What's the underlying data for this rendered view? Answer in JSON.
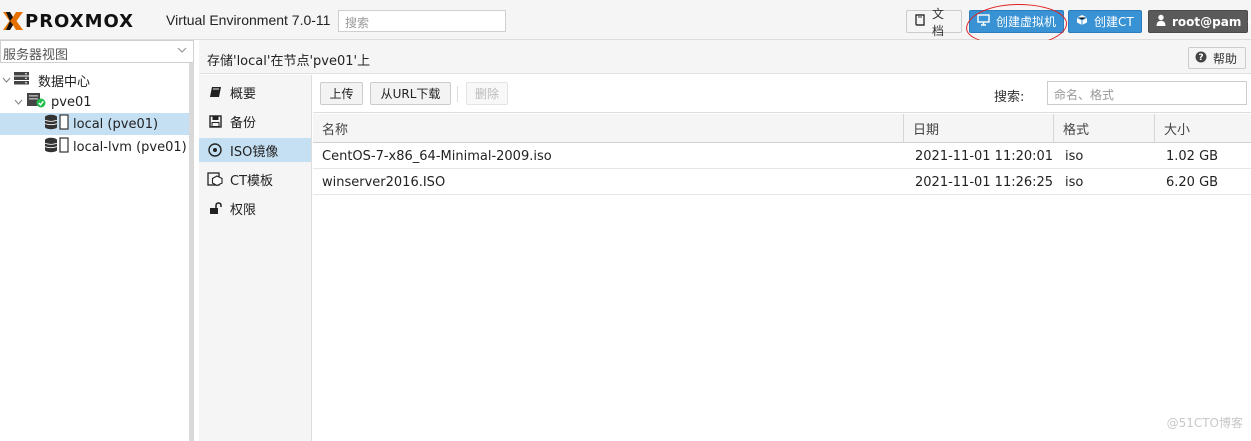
{
  "header": {
    "logo_text": "PROXMOX",
    "version": "Virtual Environment 7.0-11",
    "search_placeholder": "搜索",
    "docs_label": "文档",
    "create_vm_label": "创建虚拟机",
    "create_ct_label": "创建CT",
    "user_label": "root@pam"
  },
  "sidebar": {
    "view_selector": "服务器视图",
    "tree": [
      {
        "label": "数据中心",
        "icon": "datacenter-icon"
      },
      {
        "label": "pve01",
        "icon": "node-online-icon"
      },
      {
        "label": "local (pve01)",
        "icon": "storage-icon",
        "selected": true
      },
      {
        "label": "local-lvm (pve01)",
        "icon": "storage-icon"
      }
    ]
  },
  "main": {
    "title": "存储'local'在节点'pve01'上",
    "help_label": "帮助",
    "nav": [
      {
        "label": "概要",
        "icon": "book-icon"
      },
      {
        "label": "备份",
        "icon": "floppy-icon"
      },
      {
        "label": "ISO镜像",
        "icon": "disc-icon",
        "selected": true
      },
      {
        "label": "CT模板",
        "icon": "template-icon"
      },
      {
        "label": "权限",
        "icon": "unlock-icon"
      }
    ],
    "toolbar": {
      "upload": "上传",
      "download_url": "从URL下载",
      "remove": "删除",
      "search_label": "搜索:",
      "search_placeholder": "命名、格式"
    },
    "columns": [
      "名称",
      "日期",
      "格式",
      "大小"
    ],
    "rows": [
      [
        "CentOS-7-x86_64-Minimal-2009.iso",
        "2021-11-01 11:20:01",
        "iso",
        "1.02 GB"
      ],
      [
        "winserver2016.ISO",
        "2021-11-01 11:26:25",
        "iso",
        "6.20 GB"
      ]
    ]
  },
  "watermark": "@51CTO博客",
  "colors": {
    "accent": "#3892d4",
    "selection": "#c5dff3",
    "logo_orange": "#e57000",
    "annotation_red": "#e02020"
  }
}
